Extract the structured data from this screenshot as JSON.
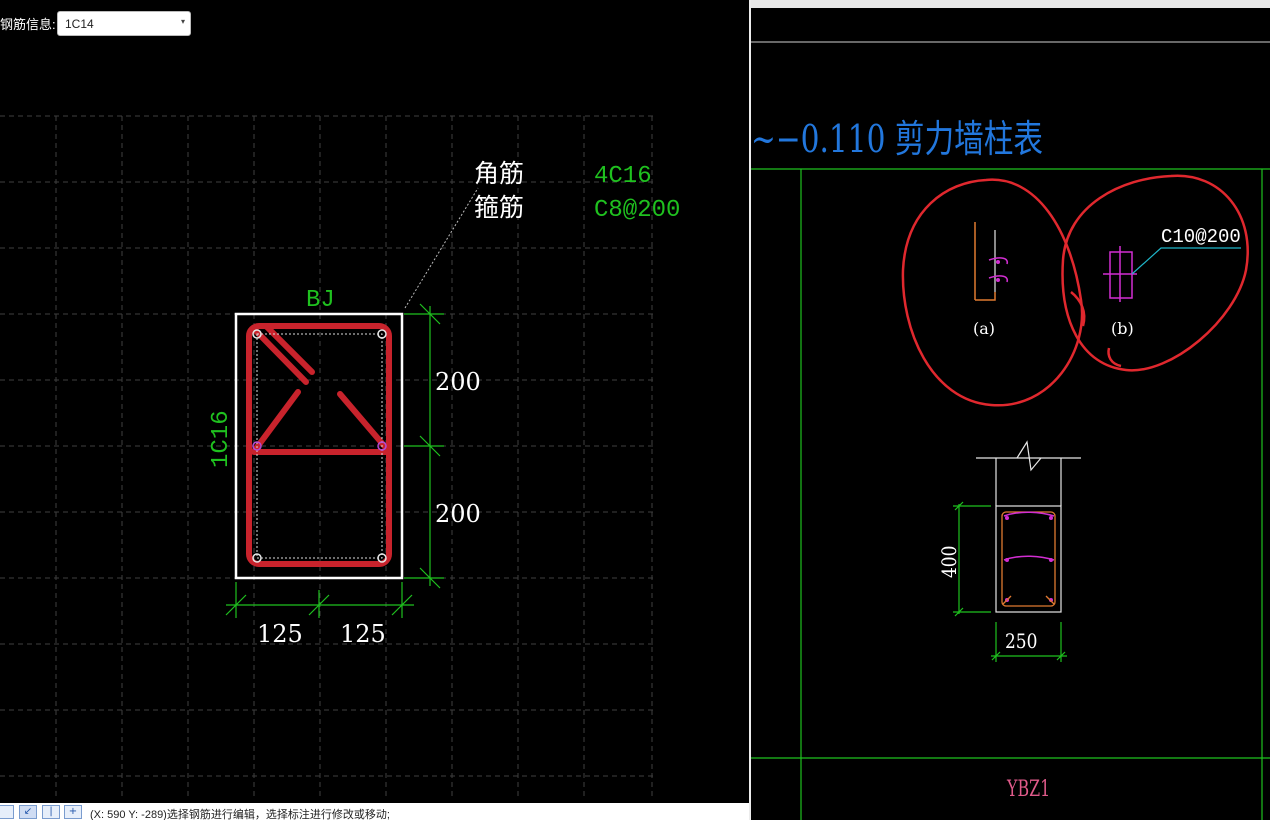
{
  "toolbar": {
    "rebar_info_label": "钢筋信息:",
    "rebar_select_value": "1C14"
  },
  "section": {
    "legend": [
      {
        "name": "角筋",
        "value": "4C16"
      },
      {
        "name": "箍筋",
        "value": "C8@200"
      }
    ],
    "member_label": "BJ",
    "side_rebar_label": "1C16",
    "dims": {
      "v1": "200",
      "v2": "200",
      "h1": "125",
      "h2": "125"
    }
  },
  "statusbar": {
    "buttons": [
      "",
      "↙",
      "|",
      "+"
    ],
    "text": "(X: 590 Y: -289)选择钢筋进行编辑，选择标注进行修改或移动;"
  },
  "drawing": {
    "title": "~−0.110 剪力墙柱表",
    "detail_a_label": "(a)",
    "detail_b_label": "(b)",
    "detail_b_rebar": "C10@200",
    "dim_height": "400",
    "dim_width": "250",
    "column_id": "YBZ1"
  },
  "colors": {
    "rebar_red": "#c8232c",
    "dim_green": "#1fc11f",
    "title_blue": "#2277dd",
    "magenta": "#d22ed2",
    "cyan": "#1fb6c9",
    "markup_red": "#e0282e"
  }
}
